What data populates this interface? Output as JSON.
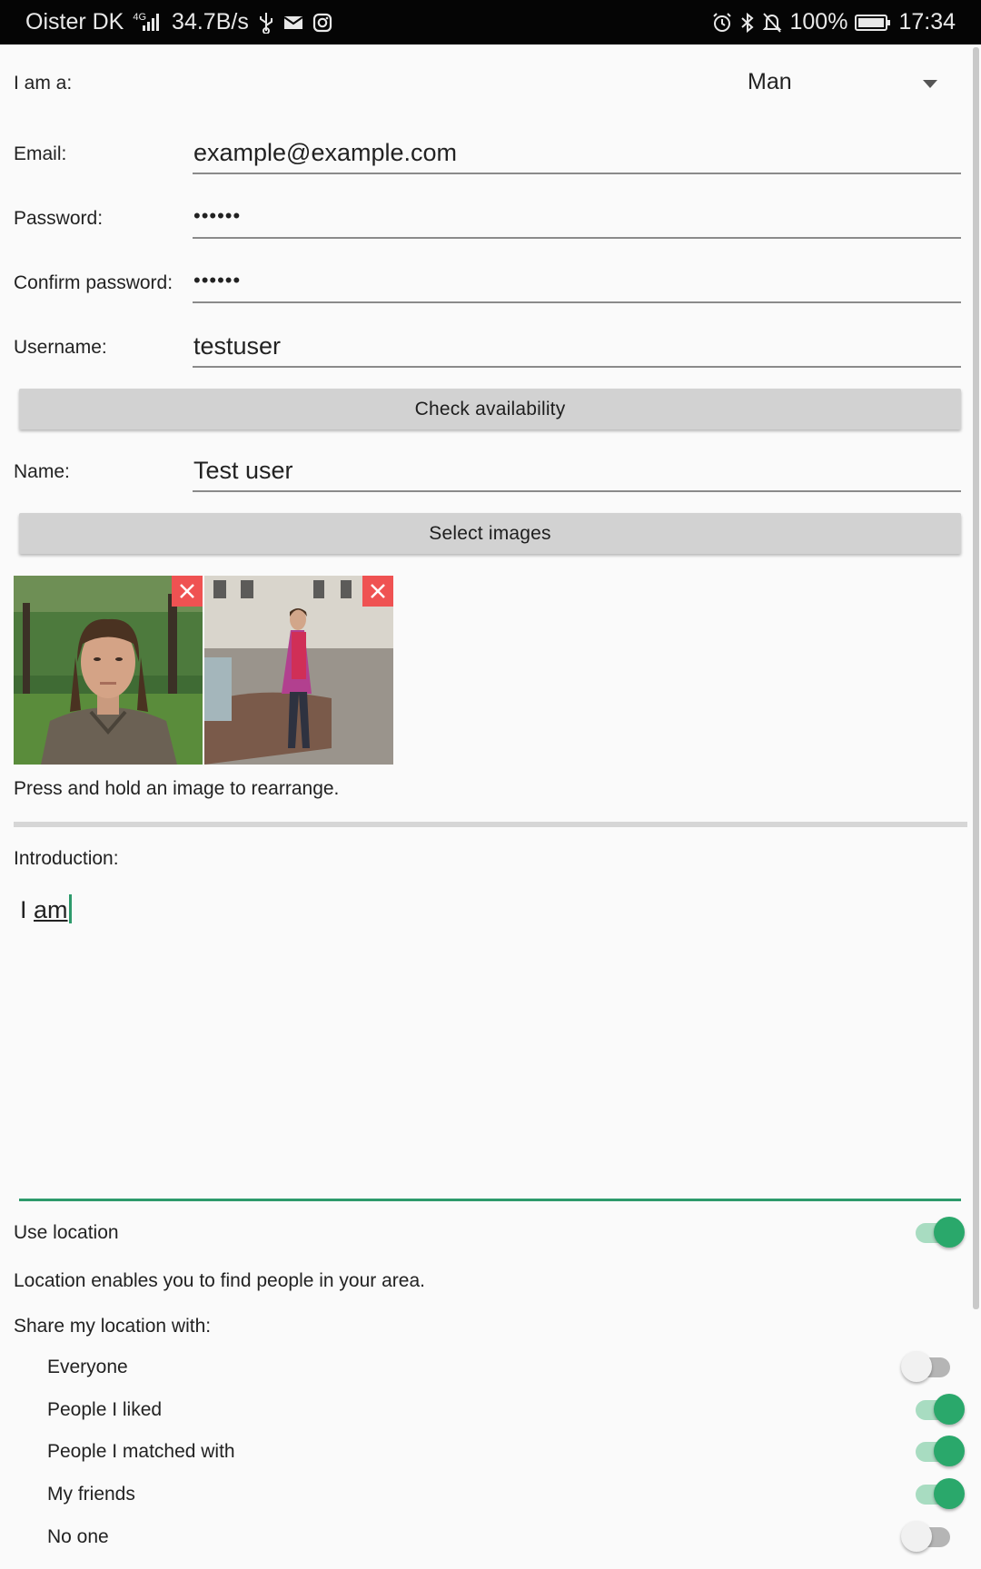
{
  "status_bar": {
    "carrier": "Oister DK",
    "network": "4G",
    "speed": "34.7B/s",
    "battery": "100%",
    "time": "17:34",
    "icons": [
      "signal-icon",
      "usb-icon",
      "mail-icon",
      "instagram-icon",
      "alarm-icon",
      "bluetooth-icon",
      "silent-icon",
      "battery-icon"
    ]
  },
  "form": {
    "gender": {
      "label": "I am a:",
      "value": "Man"
    },
    "email": {
      "label": "Email:",
      "value": "example@example.com"
    },
    "password": {
      "label": "Password:",
      "value": "••••••"
    },
    "confirm_password": {
      "label": "Confirm password:",
      "value": "••••••"
    },
    "username": {
      "label": "Username:",
      "value": "testuser"
    },
    "check_button": "Check availability",
    "name": {
      "label": "Name:",
      "value": "Test user"
    },
    "select_images_button": "Select images",
    "images_hint": "Press and hold an image to rearrange.",
    "introduction": {
      "label": "Introduction:",
      "value_pre": "I ",
      "value_word": "am"
    }
  },
  "location": {
    "use_label": "Use location",
    "use_enabled": true,
    "description": "Location enables you to find people in your area.",
    "share_label": "Share my location with:",
    "options": [
      {
        "label": "Everyone",
        "enabled": false
      },
      {
        "label": "People I liked",
        "enabled": true
      },
      {
        "label": "People I matched with",
        "enabled": true
      },
      {
        "label": "My friends",
        "enabled": true
      },
      {
        "label": "No one",
        "enabled": false
      }
    ]
  },
  "colors": {
    "accent": "#2aa86b",
    "remove": "#ef5252",
    "status_bar": "#050505"
  }
}
